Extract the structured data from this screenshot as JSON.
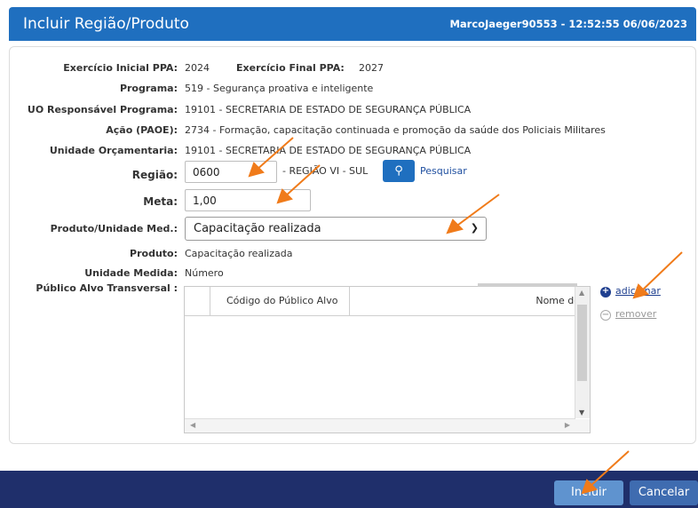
{
  "window": {
    "title": "Incluir Região/Produto",
    "user_info": "MarcoJaeger90553 - 12:52:55 06/06/2023"
  },
  "form": {
    "exercicio_inicial_label": "Exercício Inicial PPA:",
    "exercicio_inicial_value": "2024",
    "exercicio_final_label": "Exercício Final PPA:",
    "exercicio_final_value": "2027",
    "programa_label": "Programa:",
    "programa_value": "519 - Segurança proativa e inteligente",
    "uo_label": "UO Responsável Programa:",
    "uo_value": "19101 - SECRETARIA DE ESTADO DE SEGURANÇA PÚBLICA",
    "acao_label": "Ação (PAOE):",
    "acao_value": "2734 - Formação, capacitação continuada e promoção da saúde dos Policiais Militares",
    "unidade_orc_label": "Unidade Orçamentaria:",
    "unidade_orc_value": "19101 - SECRETARIA DE ESTADO DE SEGURANÇA PÚBLICA",
    "regiao_label": "Região:",
    "regiao_value": "0600",
    "regiao_desc": "- REGIÃO VI - SUL",
    "pesquisar_label": "Pesquisar",
    "meta_label": "Meta:",
    "meta_value": "1,00",
    "produto_unidade_label": "Produto/Unidade Med.:",
    "produto_unidade_selected": "Capacitação realizada",
    "produto_label": "Produto:",
    "produto_value": "Capacitação realizada",
    "unidade_medida_label": "Unidade Medida:",
    "unidade_medida_value": "Número",
    "publico_alvo_label": "Público Alvo Transversal :"
  },
  "grid": {
    "columns": [
      "Código do Público Alvo",
      "Nome do"
    ]
  },
  "actions": {
    "adicionar": "adicionar",
    "remover": "remover"
  },
  "footer": {
    "incluir": "Incluir",
    "cancelar": "Cancelar"
  },
  "colors": {
    "header_blue": "#1f6fbf",
    "footer_navy": "#1f2f6b",
    "annotation_arrow": "#f07b1a"
  }
}
